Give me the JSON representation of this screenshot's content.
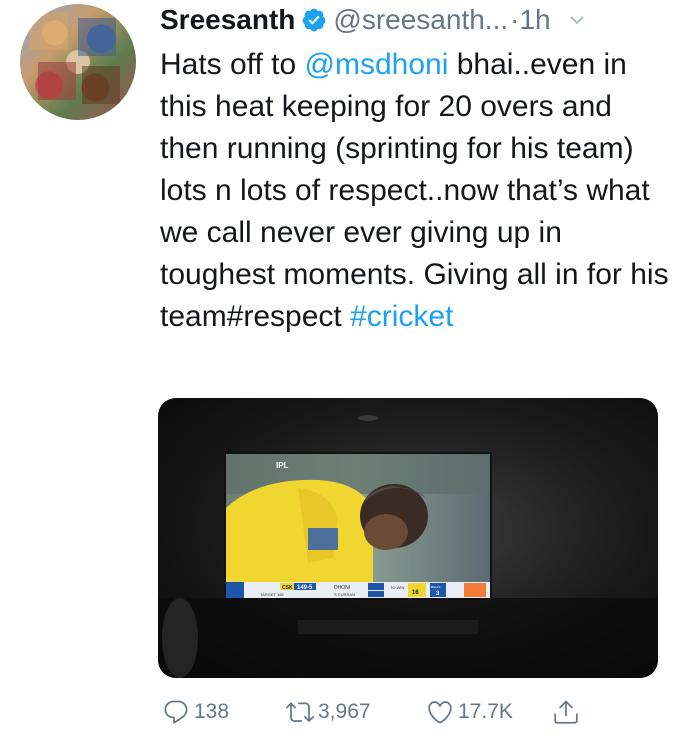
{
  "author": {
    "name": "Sreesanth",
    "handle": "@sreesanth...",
    "time": "·1h"
  },
  "tweet": {
    "text_before_mention": "Hats off to ",
    "mention": "@msdhoni",
    "text_after_mention": " bhai..even in this heat keeping for 20 overs and then running (sprinting for his team) lots n lots of respect..now that’s what we call never ever giving up in toughest moments. Giving all in for his team#respect ",
    "hashtag": "#cricket"
  },
  "scorebar": {
    "team1": "CSK",
    "score": "149-5",
    "target": "TARGET 165",
    "batsman": "DHONI",
    "bowler": "S CURRAN",
    "to_win_label": "TO WIN",
    "runs_needed": "16",
    "balls_label": "BALLS",
    "balls": "3",
    "league_logo_text": "IPL"
  },
  "actions": {
    "replies": "138",
    "retweets": "3,967",
    "likes": "17.7K"
  },
  "icons": {
    "verified": "verified-badge-icon",
    "caret": "chevron-down-icon",
    "reply": "reply-icon",
    "retweet": "retweet-icon",
    "like": "heart-icon",
    "share": "share-icon"
  },
  "colors": {
    "link": "#1da1f2",
    "muted": "#657786",
    "text": "#14171a",
    "jersey_yellow": "#f2d630"
  }
}
